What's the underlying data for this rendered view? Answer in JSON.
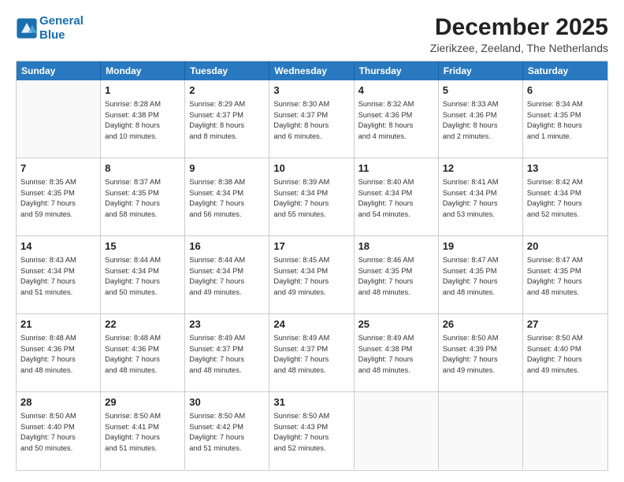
{
  "header": {
    "logo_line1": "General",
    "logo_line2": "Blue",
    "month": "December 2025",
    "location": "Zierikzee, Zeeland, The Netherlands"
  },
  "days_of_week": [
    "Sunday",
    "Monday",
    "Tuesday",
    "Wednesday",
    "Thursday",
    "Friday",
    "Saturday"
  ],
  "weeks": [
    [
      {
        "day": "",
        "info": ""
      },
      {
        "day": "1",
        "info": "Sunrise: 8:28 AM\nSunset: 4:38 PM\nDaylight: 8 hours\nand 10 minutes."
      },
      {
        "day": "2",
        "info": "Sunrise: 8:29 AM\nSunset: 4:37 PM\nDaylight: 8 hours\nand 8 minutes."
      },
      {
        "day": "3",
        "info": "Sunrise: 8:30 AM\nSunset: 4:37 PM\nDaylight: 8 hours\nand 6 minutes."
      },
      {
        "day": "4",
        "info": "Sunrise: 8:32 AM\nSunset: 4:36 PM\nDaylight: 8 hours\nand 4 minutes."
      },
      {
        "day": "5",
        "info": "Sunrise: 8:33 AM\nSunset: 4:36 PM\nDaylight: 8 hours\nand 2 minutes."
      },
      {
        "day": "6",
        "info": "Sunrise: 8:34 AM\nSunset: 4:35 PM\nDaylight: 8 hours\nand 1 minute."
      }
    ],
    [
      {
        "day": "7",
        "info": "Sunrise: 8:35 AM\nSunset: 4:35 PM\nDaylight: 7 hours\nand 59 minutes."
      },
      {
        "day": "8",
        "info": "Sunrise: 8:37 AM\nSunset: 4:35 PM\nDaylight: 7 hours\nand 58 minutes."
      },
      {
        "day": "9",
        "info": "Sunrise: 8:38 AM\nSunset: 4:34 PM\nDaylight: 7 hours\nand 56 minutes."
      },
      {
        "day": "10",
        "info": "Sunrise: 8:39 AM\nSunset: 4:34 PM\nDaylight: 7 hours\nand 55 minutes."
      },
      {
        "day": "11",
        "info": "Sunrise: 8:40 AM\nSunset: 4:34 PM\nDaylight: 7 hours\nand 54 minutes."
      },
      {
        "day": "12",
        "info": "Sunrise: 8:41 AM\nSunset: 4:34 PM\nDaylight: 7 hours\nand 53 minutes."
      },
      {
        "day": "13",
        "info": "Sunrise: 8:42 AM\nSunset: 4:34 PM\nDaylight: 7 hours\nand 52 minutes."
      }
    ],
    [
      {
        "day": "14",
        "info": "Sunrise: 8:43 AM\nSunset: 4:34 PM\nDaylight: 7 hours\nand 51 minutes."
      },
      {
        "day": "15",
        "info": "Sunrise: 8:44 AM\nSunset: 4:34 PM\nDaylight: 7 hours\nand 50 minutes."
      },
      {
        "day": "16",
        "info": "Sunrise: 8:44 AM\nSunset: 4:34 PM\nDaylight: 7 hours\nand 49 minutes."
      },
      {
        "day": "17",
        "info": "Sunrise: 8:45 AM\nSunset: 4:34 PM\nDaylight: 7 hours\nand 49 minutes."
      },
      {
        "day": "18",
        "info": "Sunrise: 8:46 AM\nSunset: 4:35 PM\nDaylight: 7 hours\nand 48 minutes."
      },
      {
        "day": "19",
        "info": "Sunrise: 8:47 AM\nSunset: 4:35 PM\nDaylight: 7 hours\nand 48 minutes."
      },
      {
        "day": "20",
        "info": "Sunrise: 8:47 AM\nSunset: 4:35 PM\nDaylight: 7 hours\nand 48 minutes."
      }
    ],
    [
      {
        "day": "21",
        "info": "Sunrise: 8:48 AM\nSunset: 4:36 PM\nDaylight: 7 hours\nand 48 minutes."
      },
      {
        "day": "22",
        "info": "Sunrise: 8:48 AM\nSunset: 4:36 PM\nDaylight: 7 hours\nand 48 minutes."
      },
      {
        "day": "23",
        "info": "Sunrise: 8:49 AM\nSunset: 4:37 PM\nDaylight: 7 hours\nand 48 minutes."
      },
      {
        "day": "24",
        "info": "Sunrise: 8:49 AM\nSunset: 4:37 PM\nDaylight: 7 hours\nand 48 minutes."
      },
      {
        "day": "25",
        "info": "Sunrise: 8:49 AM\nSunset: 4:38 PM\nDaylight: 7 hours\nand 48 minutes."
      },
      {
        "day": "26",
        "info": "Sunrise: 8:50 AM\nSunset: 4:39 PM\nDaylight: 7 hours\nand 49 minutes."
      },
      {
        "day": "27",
        "info": "Sunrise: 8:50 AM\nSunset: 4:40 PM\nDaylight: 7 hours\nand 49 minutes."
      }
    ],
    [
      {
        "day": "28",
        "info": "Sunrise: 8:50 AM\nSunset: 4:40 PM\nDaylight: 7 hours\nand 50 minutes."
      },
      {
        "day": "29",
        "info": "Sunrise: 8:50 AM\nSunset: 4:41 PM\nDaylight: 7 hours\nand 51 minutes."
      },
      {
        "day": "30",
        "info": "Sunrise: 8:50 AM\nSunset: 4:42 PM\nDaylight: 7 hours\nand 51 minutes."
      },
      {
        "day": "31",
        "info": "Sunrise: 8:50 AM\nSunset: 4:43 PM\nDaylight: 7 hours\nand 52 minutes."
      },
      {
        "day": "",
        "info": ""
      },
      {
        "day": "",
        "info": ""
      },
      {
        "day": "",
        "info": ""
      }
    ]
  ]
}
